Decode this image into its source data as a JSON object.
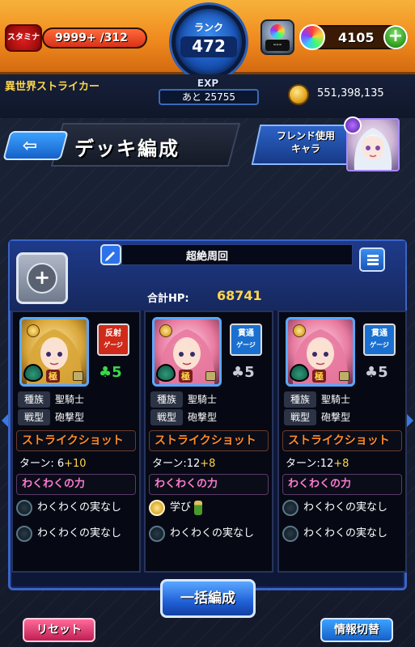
{
  "topbar": {
    "stamina_label": "スタミナ",
    "stamina_text": "9999+ /312",
    "stamina_level": 1.0,
    "rank_label": "ランク",
    "rank_value": "472",
    "exp_label": "EXP",
    "exp_remaining": "あと 25755",
    "gacha_text": "---",
    "orbs": "4105",
    "plus_symbol": "+"
  },
  "profile": {
    "title": "異世界ストライカー",
    "coins": "551,398,135"
  },
  "header": {
    "back_arrow": "⇦",
    "title": "デッキ編成",
    "friend_button_line1": "フレンド使用",
    "friend_button_line2": "キャラ"
  },
  "deck": {
    "name": "超絶周回",
    "total_hp_label": "合計HP:",
    "total_hp": "68741",
    "heart_symbol": "+"
  },
  "cards": [
    {
      "gauge": "反射",
      "gauge_sub": "ゲージ",
      "gauge_color": "#d02a1a",
      "clover": "5",
      "clover_color": "#3ad64a",
      "kiwami": "極",
      "race_key": "種族",
      "race": "聖騎士",
      "type_key": "戦型",
      "type": "砲撃型",
      "skill": "ストライクショット",
      "turn_label": "ターン: 6",
      "turn_plus": "+10",
      "ability": "わくわくの力",
      "items": [
        "わくわくの実なし",
        "わくわくの実なし"
      ],
      "portrait_colors": [
        "#ffe9a0",
        "#d8a63a",
        "#6a4410"
      ]
    },
    {
      "gauge": "貫通",
      "gauge_sub": "ゲージ",
      "gauge_color": "#1a70d0",
      "clover": "5",
      "clover_color": "#c8ccd4",
      "kiwami": "極",
      "race_key": "種族",
      "race": "聖騎士",
      "type_key": "戦型",
      "type": "砲撃型",
      "skill": "ストライクショット",
      "turn_label": "ターン:12",
      "turn_plus": "+8",
      "ability": "わくわくの力",
      "items": [
        "学び",
        "わくわくの実なし"
      ],
      "portrait_colors": [
        "#ffd6e4",
        "#e87aa0",
        "#6a2a48"
      ]
    },
    {
      "gauge": "貫通",
      "gauge_sub": "ゲージ",
      "gauge_color": "#1a70d0",
      "clover": "5",
      "clover_color": "#c8ccd4",
      "kiwami": "極",
      "race_key": "種族",
      "race": "聖騎士",
      "type_key": "戦型",
      "type": "砲撃型",
      "skill": "ストライクショット",
      "turn_label": "ターン:12",
      "turn_plus": "+8",
      "ability": "わくわくの力",
      "items": [
        "わくわくの実なし",
        "わくわくの実なし"
      ],
      "portrait_colors": [
        "#ffd6e4",
        "#e87aa0",
        "#6a2a48"
      ]
    }
  ],
  "bottom": {
    "bulk_edit": "一括編成",
    "reset": "リセット",
    "info_toggle": "情報切替"
  },
  "icons": {
    "stamina": "stamina-icon",
    "rank": "rank-badge",
    "gacha": "gacha-icon",
    "orb": "orb-icon",
    "coin": "coin-icon",
    "edit": "pencil-icon",
    "menu": "list-menu-icon",
    "heart": "heart-icon"
  }
}
